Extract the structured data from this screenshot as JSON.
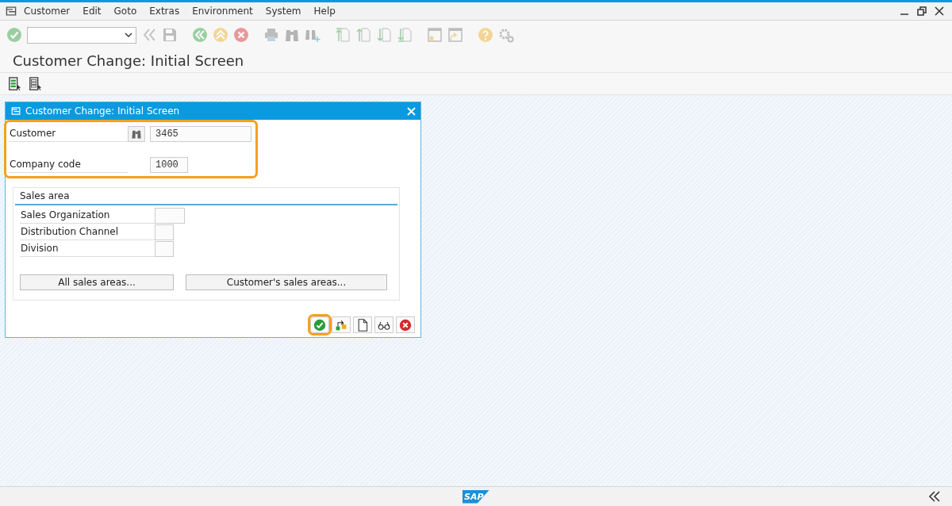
{
  "menu": [
    {
      "label": "Customer"
    },
    {
      "label": "Edit"
    },
    {
      "label": "Goto"
    },
    {
      "label": "Extras"
    },
    {
      "label": "Environment"
    },
    {
      "label": "System"
    },
    {
      "label": "Help"
    }
  ],
  "toolbar": [
    {
      "kind": "enter",
      "disabled": true
    },
    {
      "kind": "command-field"
    },
    {
      "kind": "back-arrows",
      "disabled": true
    },
    {
      "kind": "save",
      "disabled": true
    },
    {
      "kind": "back",
      "disabled": true
    },
    {
      "kind": "exit",
      "disabled": true
    },
    {
      "kind": "cancel",
      "disabled": true
    },
    {
      "kind": "print",
      "disabled": true
    },
    {
      "kind": "find",
      "disabled": true
    },
    {
      "kind": "find-next",
      "disabled": true
    },
    {
      "kind": "first-page",
      "disabled": true
    },
    {
      "kind": "previous-page",
      "disabled": true
    },
    {
      "kind": "next-page",
      "disabled": true
    },
    {
      "kind": "last-page",
      "disabled": true
    },
    {
      "kind": "new-session",
      "disabled": true
    },
    {
      "kind": "shortcut",
      "disabled": true
    },
    {
      "kind": "help",
      "disabled": true
    },
    {
      "kind": "settings",
      "disabled": true
    }
  ],
  "screen_title": "Customer Change: Initial Screen",
  "app_toolbar": [
    {
      "kind": "list-select"
    },
    {
      "kind": "list-select-outline"
    }
  ],
  "dialog": {
    "title": "Customer Change: Initial Screen",
    "key_fields": {
      "highlighted": true,
      "fields": [
        {
          "label": "Customer",
          "value": "3465",
          "search_help": true
        },
        {
          "label": "Company code",
          "value": "1000",
          "search_help": false
        }
      ]
    },
    "sales_area": {
      "title": "Sales area",
      "fields": [
        {
          "label": "Sales Organization"
        },
        {
          "label": "Distribution Channel"
        },
        {
          "label": "Division"
        }
      ],
      "buttons": [
        {
          "label": "All sales areas..."
        },
        {
          "label": "Customer's sales areas..."
        }
      ]
    },
    "buttons": [
      {
        "kind": "enter",
        "highlighted": true
      },
      {
        "kind": "hierarchy",
        "highlighted": false
      },
      {
        "kind": "new",
        "highlighted": false
      },
      {
        "kind": "display",
        "highlighted": false
      },
      {
        "kind": "cancel",
        "highlighted": false
      }
    ]
  },
  "status_bar": {
    "logo": "SAP"
  }
}
